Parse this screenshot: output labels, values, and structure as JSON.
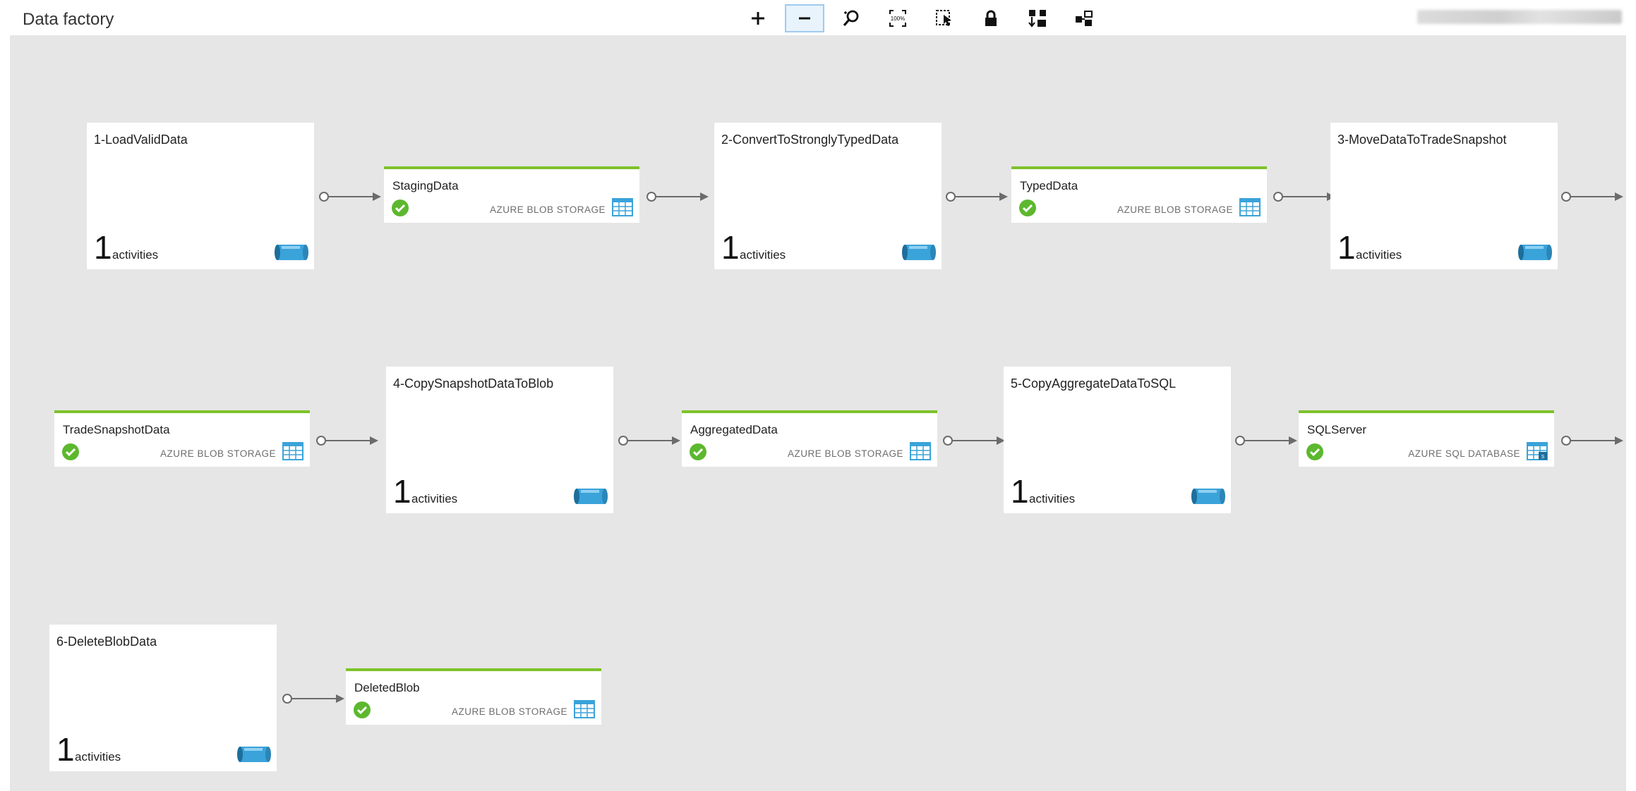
{
  "header": {
    "title": "Data factory"
  },
  "toolbar": {
    "buttons": [
      {
        "name": "zoom-in",
        "icon": "plus-icon"
      },
      {
        "name": "zoom-out",
        "icon": "minus-icon",
        "active": true
      },
      {
        "name": "zoom-to-fit",
        "icon": "search-fit-icon"
      },
      {
        "name": "actual-size",
        "icon": "zoom-100-icon",
        "label": "100%"
      },
      {
        "name": "select",
        "icon": "selection-cursor-icon"
      },
      {
        "name": "lock-layout",
        "icon": "lock-icon"
      },
      {
        "name": "auto-arrange",
        "icon": "auto-arrange-icon"
      },
      {
        "name": "diagram-layout",
        "icon": "diagram-layout-icon"
      }
    ]
  },
  "pipelines": [
    {
      "name": "1-LoadValidData",
      "count": "1",
      "count_label": "activities",
      "icon": "pipeline-cylinder-icon"
    },
    {
      "name": "2-ConvertToStronglyTypedData",
      "count": "1",
      "count_label": "activities",
      "icon": "pipeline-cylinder-icon"
    },
    {
      "name": "3-MoveDataToTradeSnapshot",
      "count": "1",
      "count_label": "activities",
      "icon": "pipeline-cylinder-icon"
    },
    {
      "name": "4-CopySnapshotDataToBlob",
      "count": "1",
      "count_label": "activities",
      "icon": "pipeline-cylinder-icon"
    },
    {
      "name": "5-CopyAggregateDataToSQL",
      "count": "1",
      "count_label": "activities",
      "icon": "pipeline-cylinder-icon"
    },
    {
      "name": "6-DeleteBlobData",
      "count": "1",
      "count_label": "activities",
      "icon": "pipeline-cylinder-icon"
    }
  ],
  "datasets": [
    {
      "name": "StagingData",
      "type": "AZURE BLOB STORAGE",
      "status": "ok",
      "icon": "blob-table-icon"
    },
    {
      "name": "TypedData",
      "type": "AZURE BLOB STORAGE",
      "status": "ok",
      "icon": "blob-table-icon"
    },
    {
      "name": "TradeSnapshotData",
      "type": "AZURE BLOB STORAGE",
      "status": "ok",
      "icon": "blob-table-icon"
    },
    {
      "name": "AggregatedData",
      "type": "AZURE BLOB STORAGE",
      "status": "ok",
      "icon": "blob-table-icon"
    },
    {
      "name": "SQLServer",
      "type": "AZURE SQL DATABASE",
      "status": "ok",
      "icon": "sql-table-icon"
    },
    {
      "name": "DeletedBlob",
      "type": "AZURE BLOB STORAGE",
      "status": "ok",
      "icon": "blob-table-icon"
    }
  ],
  "colors": {
    "canvas": "#e6e6e6",
    "dataset_accent": "#7ec22a",
    "status_ok": "#5cb82e",
    "cylinder": "#3aa3d9",
    "connector": "#6b6b6b",
    "toolbar_active": "#e8f3fc"
  }
}
